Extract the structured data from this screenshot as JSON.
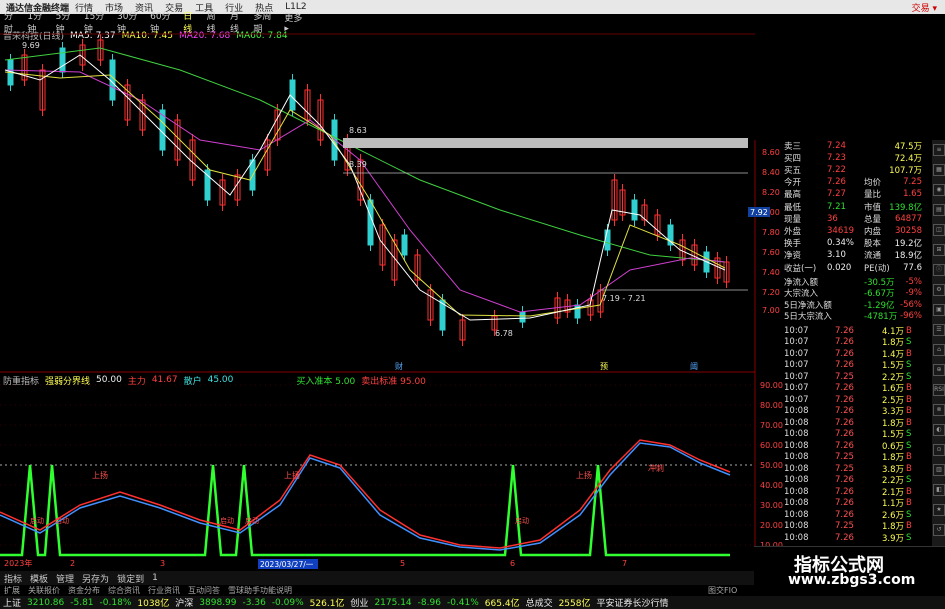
{
  "titlebar": {
    "app_name": "通达信金融终端",
    "menus": [
      "行情",
      "市场",
      "资讯",
      "交易",
      "工具",
      "行业",
      "热点",
      "L1L2"
    ],
    "right_label": "交易 ▾"
  },
  "periods": [
    "分时",
    "1分钟",
    "5分钟",
    "15分钟",
    "30分钟",
    "60分钟",
    "日线",
    "周线",
    "月线",
    "多周期",
    "更多 ▸"
  ],
  "ma_line": {
    "stock": "晋荣科技(日线)",
    "ma5": "MA5: 7.37",
    "ma10": "MA10: 7.45",
    "ma20": "MA20: 7.68",
    "ma60": "MA60: 7.84"
  },
  "colors": {
    "ma5": "#ffffff",
    "ma10": "#ffff40",
    "ma20": "#ff40ff",
    "ma60": "#40ff40",
    "up": "#ff3030",
    "down": "#30e0e0",
    "accent_red": "#ff3030",
    "green_line": "#30ff30",
    "blue_line": "#4090ff"
  },
  "price_annotations": {
    "high": "9.69",
    "mid1": "8.63",
    "mid2": "8.39",
    "low": "6.78",
    "box_range": "7.19 - 7.21"
  },
  "price_axis": [
    "8.60",
    "8.40",
    "8.20",
    "8.00",
    "7.80",
    "7.60",
    "7.40",
    "7.20",
    "7.00"
  ],
  "current_price_tag": "7.92",
  "event_marks": [
    "财",
    "预",
    "阈"
  ],
  "indicator": {
    "name": "防重指标",
    "sub": "强弱分界线",
    "v1": "50.00",
    "v2_label": "主力",
    "v2": "41.67",
    "v3_label": "散户",
    "v3": "45.00",
    "v4": "买入准本 5.00",
    "v5": "卖出标准 95.00"
  },
  "indicator_axis": [
    "90.00",
    "80.00",
    "70.00",
    "60.00",
    "50.00",
    "40.00",
    "30.00",
    "20.00",
    "10.00"
  ],
  "ind_labels": {
    "up1": "上扬",
    "up2": "上扬",
    "up3": "上扬",
    "act1": "启动",
    "act2": "启动",
    "act3": "启动",
    "act4": "启动",
    "act5": "启动",
    "peak": "冲刺"
  },
  "x_axis": [
    "2023年",
    "2",
    "3",
    "4",
    "5",
    "6",
    "7"
  ],
  "date_tag": "2023/03/27/一",
  "quote": [
    {
      "l": "卖三",
      "v1": "7.24",
      "v2": "47.5万",
      "c": "red"
    },
    {
      "l": "买四",
      "v1": "7.23",
      "v2": "72.4万",
      "c": "red"
    },
    {
      "l": "买五",
      "v1": "7.22",
      "v2": "107.7万",
      "c": "red"
    },
    {
      "l": "今开",
      "v1": "7.26",
      "k2": "均价",
      "v2": "7.25",
      "c": "red"
    },
    {
      "l": "最高",
      "v1": "7.27",
      "k2": "量比",
      "v2": "1.65",
      "c": "red"
    },
    {
      "l": "最低",
      "v1": "7.21",
      "k2": "市值",
      "v2": "139.8亿",
      "c": "green"
    },
    {
      "l": "现量",
      "v1": "36",
      "k2": "总量",
      "v2": "64877",
      "c": "red"
    },
    {
      "l": "外盘",
      "v1": "34619",
      "k2": "内盘",
      "v2": "30258",
      "c": "red"
    },
    {
      "l": "换手",
      "v1": "0.34%",
      "k2": "股本",
      "v2": "19.2亿",
      "c": "white"
    },
    {
      "l": "净资",
      "v1": "3.10",
      "k2": "流通",
      "v2": "18.9亿",
      "c": "white"
    },
    {
      "l": "收益(一)",
      "v1": "0.020",
      "k2": "PE(动)",
      "v2": "77.6",
      "c": "white"
    }
  ],
  "flow": [
    {
      "l": "净流入额",
      "v": "-30.5万",
      "p": "-5%"
    },
    {
      "l": "大宗流入",
      "v": "-6.67万",
      "p": "-9%"
    },
    {
      "l": "5日净流入额",
      "v": "-1.29亿",
      "p": "-56%"
    },
    {
      "l": "5日大宗流入",
      "v": "-4781万",
      "p": "-96%"
    }
  ],
  "ticks": [
    {
      "t": "10:07",
      "p": "7.26",
      "v": "4.1万",
      "s": "B"
    },
    {
      "t": "10:07",
      "p": "7.26",
      "v": "1.8万",
      "s": "S"
    },
    {
      "t": "10:07",
      "p": "7.26",
      "v": "1.4万",
      "s": "B"
    },
    {
      "t": "10:07",
      "p": "7.26",
      "v": "1.5万",
      "s": "S"
    },
    {
      "t": "10:07",
      "p": "7.25",
      "v": "2.2万",
      "s": "S"
    },
    {
      "t": "10:07",
      "p": "7.26",
      "v": "1.6万",
      "s": "B"
    },
    {
      "t": "10:07",
      "p": "7.26",
      "v": "2.5万",
      "s": "B"
    },
    {
      "t": "10:08",
      "p": "7.26",
      "v": "3.3万",
      "s": "B"
    },
    {
      "t": "10:08",
      "p": "7.26",
      "v": "1.8万",
      "s": "B"
    },
    {
      "t": "10:08",
      "p": "7.26",
      "v": "1.5万",
      "s": "S"
    },
    {
      "t": "10:08",
      "p": "7.26",
      "v": "0.6万",
      "s": "S"
    },
    {
      "t": "10:08",
      "p": "7.25",
      "v": "1.8万",
      "s": "B"
    },
    {
      "t": "10:08",
      "p": "7.25",
      "v": "3.8万",
      "s": "B"
    },
    {
      "t": "10:08",
      "p": "7.26",
      "v": "2.2万",
      "s": "S"
    },
    {
      "t": "10:08",
      "p": "7.26",
      "v": "2.1万",
      "s": "B"
    },
    {
      "t": "10:08",
      "p": "7.26",
      "v": "1.1万",
      "s": "B"
    },
    {
      "t": "10:08",
      "p": "7.26",
      "v": "2.6万",
      "s": "S"
    },
    {
      "t": "10:08",
      "p": "7.25",
      "v": "1.8万",
      "s": "B"
    },
    {
      "t": "10:08",
      "p": "7.26",
      "v": "3.9万",
      "s": "S"
    }
  ],
  "bottom_tabs": [
    "指标",
    "模板",
    "管理",
    "另存为",
    "锁定到",
    "1"
  ],
  "sub_tabs": [
    "扩展",
    "关联报价",
    "资金分布",
    "综合资讯",
    "行业资讯",
    "互动问答",
    "雪球助手功能说明"
  ],
  "side_icons": [
    "≡",
    "▦",
    "◉",
    "▤",
    "◫",
    "⊞",
    "ⓘ",
    "⚙",
    "▣",
    "☰",
    "⌂",
    "⊕",
    "RSI",
    "⊗",
    "◐",
    "⊙",
    "▥",
    "◧",
    "★",
    "↺"
  ],
  "status": [
    {
      "t": "上证",
      "c": "white"
    },
    {
      "t": "3210.86",
      "c": "green"
    },
    {
      "t": "-5.81",
      "c": "green"
    },
    {
      "t": "-0.18%",
      "c": "green"
    },
    {
      "t": "1038亿",
      "c": "yellow"
    },
    {
      "t": "沪深",
      "c": "white"
    },
    {
      "t": "3898.99",
      "c": "green"
    },
    {
      "t": "-3.36",
      "c": "green"
    },
    {
      "t": "-0.09%",
      "c": "green"
    },
    {
      "t": "526.1亿",
      "c": "yellow"
    },
    {
      "t": "创业",
      "c": "white"
    },
    {
      "t": "2175.14",
      "c": "green"
    },
    {
      "t": "-8.96",
      "c": "green"
    },
    {
      "t": "-0.41%",
      "c": "green"
    },
    {
      "t": "665.4亿",
      "c": "yellow"
    },
    {
      "t": "总成交",
      "c": "white"
    },
    {
      "t": "2558亿",
      "c": "yellow"
    },
    {
      "t": "平安证券长沙行情",
      "c": "white"
    }
  ],
  "right_label_bottom": "图交FIO",
  "watermark": {
    "line1": "指标公式网",
    "line2": "www.zbgs3.com"
  }
}
